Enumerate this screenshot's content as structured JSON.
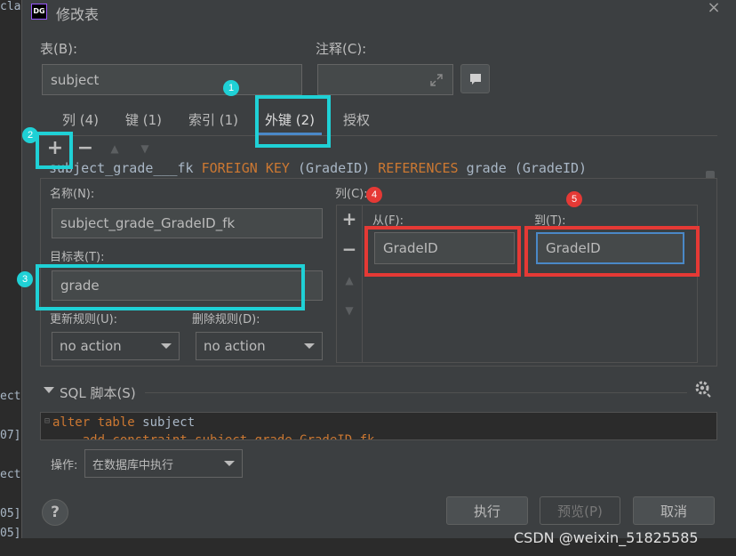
{
  "background": {
    "lines": [
      "class",
      "ect",
      "07]",
      "ect",
      "05]",
      "05]"
    ]
  },
  "dialog": {
    "logo": "DG",
    "title": "修改表",
    "close": "×"
  },
  "form": {
    "table_label": "表(B):",
    "table_value": "subject",
    "comment_label": "注释(C):",
    "comment_value": ""
  },
  "tabs": [
    {
      "label": "列 (4)"
    },
    {
      "label": "键 (1)"
    },
    {
      "label": "索引 (1)"
    },
    {
      "label": "外键 (2)",
      "active": true
    },
    {
      "label": "授权"
    }
  ],
  "toolbar": {
    "add": "+",
    "remove": "−",
    "up": "▲",
    "down": "▼"
  },
  "ddl": {
    "name": "subject_grade___fk",
    "kw1": "FOREIGN KEY",
    "cols": "(GradeID)",
    "kw2": "REFERENCES",
    "ref": "grade (GradeID)"
  },
  "fk": {
    "name_label": "名称(N):",
    "name_value": "subject_grade_GradeID_fk",
    "target_label": "目标表(T):",
    "target_value": "grade",
    "update_label": "更新规则(U):",
    "update_value": "no action",
    "delete_label": "删除规则(D):",
    "delete_value": "no action",
    "columns_label": "列(C):",
    "from_label": "从(F):",
    "from_value": "GradeID",
    "to_label": "到(T):",
    "to_value": "GradeID",
    "col_add": "+",
    "col_remove": "−",
    "col_up": "▲",
    "col_down": "▼"
  },
  "sql": {
    "section_label": "SQL 脚本(S)",
    "line1_kw": "alter table",
    "line1_rest": " subject",
    "line2": "    add constraint subject_grade_GradeID_fk"
  },
  "operation": {
    "label": "操作:",
    "value": "在数据库中执行"
  },
  "buttons": {
    "help": "?",
    "execute": "执行",
    "preview": "预览(P)",
    "cancel": "取消"
  },
  "badges": [
    "1",
    "2",
    "3",
    "4",
    "5"
  ],
  "watermark": "CSDN @weixin_51825585",
  "colors": {
    "highlight_cyan": "#1fd1d6",
    "highlight_red": "#e53935",
    "keyword": "#cc7832",
    "tab_accent": "#4a88c7"
  }
}
